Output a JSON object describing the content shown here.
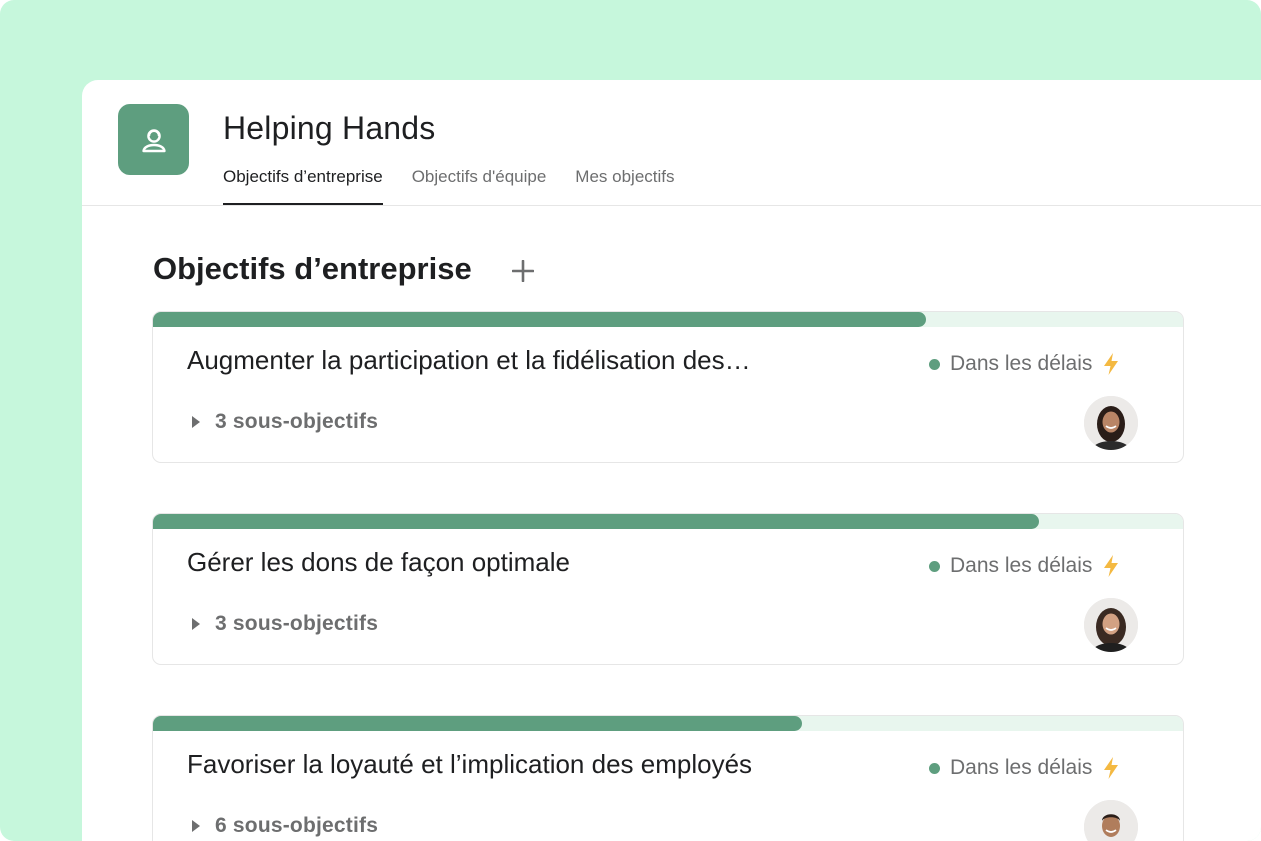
{
  "app": {
    "title": "Helping Hands",
    "logo_icon": "people-icon",
    "logo_color": "#5e9e7f"
  },
  "tabs": [
    {
      "label": "Objectifs d’entreprise",
      "active": true
    },
    {
      "label": "Objectifs d'équipe",
      "active": false
    },
    {
      "label": "Mes objectifs",
      "active": false
    }
  ],
  "section": {
    "title": "Objectifs d’entreprise",
    "add_icon": "plus-icon"
  },
  "colors": {
    "background": "#c6f7dc",
    "accent": "#5e9e7f",
    "progress_track": "#e8f6ee",
    "status_icon": "#f4b942"
  },
  "goals": [
    {
      "title": "Augmenter la participation et la fidélisation des…",
      "status": "Dans les délais",
      "status_icon": "lightning-icon",
      "subgoals": "3 sous-objectifs",
      "progress": 0.75,
      "avatar": "avatar-woman-1"
    },
    {
      "title": "Gérer les dons de façon optimale",
      "status": "Dans les délais",
      "status_icon": "lightning-icon",
      "subgoals": "3 sous-objectifs",
      "progress": 0.86,
      "avatar": "avatar-woman-2"
    },
    {
      "title": "Favoriser la loyauté et l’implication des employés",
      "status": "Dans les délais",
      "status_icon": "lightning-icon",
      "subgoals": "6 sous-objectifs",
      "progress": 0.63,
      "avatar": "avatar-man-1"
    }
  ]
}
